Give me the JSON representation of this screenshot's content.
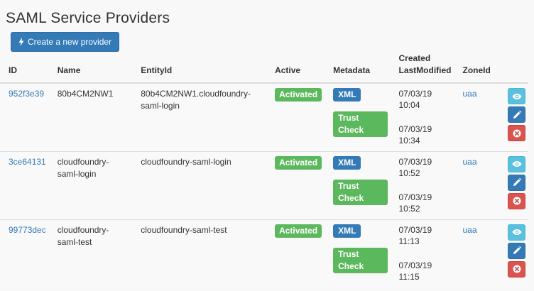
{
  "page": {
    "title": "SAML Service Providers",
    "create_button": "Create a new provider",
    "bolt_icon": "bolt-icon"
  },
  "table": {
    "headers": {
      "id": "ID",
      "name": "Name",
      "entity_id": "EntityId",
      "active": "Active",
      "metadata": "Metadata",
      "created": "Created",
      "last_modified": "LastModified",
      "zone_id": "ZoneId"
    },
    "rows": [
      {
        "id": "952f3e39",
        "name": "80b4CM2NW1",
        "entity_id": "80b4CM2NW1.cloudfoundry-saml-login",
        "active": "Activated",
        "xml": "XML",
        "trust_check": "Trust Check",
        "created": "07/03/19 10:04",
        "last_modified": "07/03/19 10:34",
        "zone_id": "uaa"
      },
      {
        "id": "3ce64131",
        "name": "cloudfoundry-saml-login",
        "entity_id": "cloudfoundry-saml-login",
        "active": "Activated",
        "xml": "XML",
        "trust_check": "Trust Check",
        "created": "07/03/19 10:52",
        "last_modified": "07/03/19 10:52",
        "zone_id": "uaa"
      },
      {
        "id": "99773dec",
        "name": "cloudfoundry-saml-test",
        "entity_id": "cloudfoundry-saml-test",
        "active": "Activated",
        "xml": "XML",
        "trust_check": "Trust Check",
        "created": "07/03/19 11:13",
        "last_modified": "07/03/19 11:15",
        "zone_id": "uaa"
      }
    ]
  },
  "icons": {
    "view": "eye-icon",
    "edit": "pencil-icon",
    "delete": "remove-circle-icon"
  },
  "colors": {
    "primary": "#337ab7",
    "success": "#5cb85c",
    "info": "#5bc0de",
    "danger": "#d9534f"
  }
}
